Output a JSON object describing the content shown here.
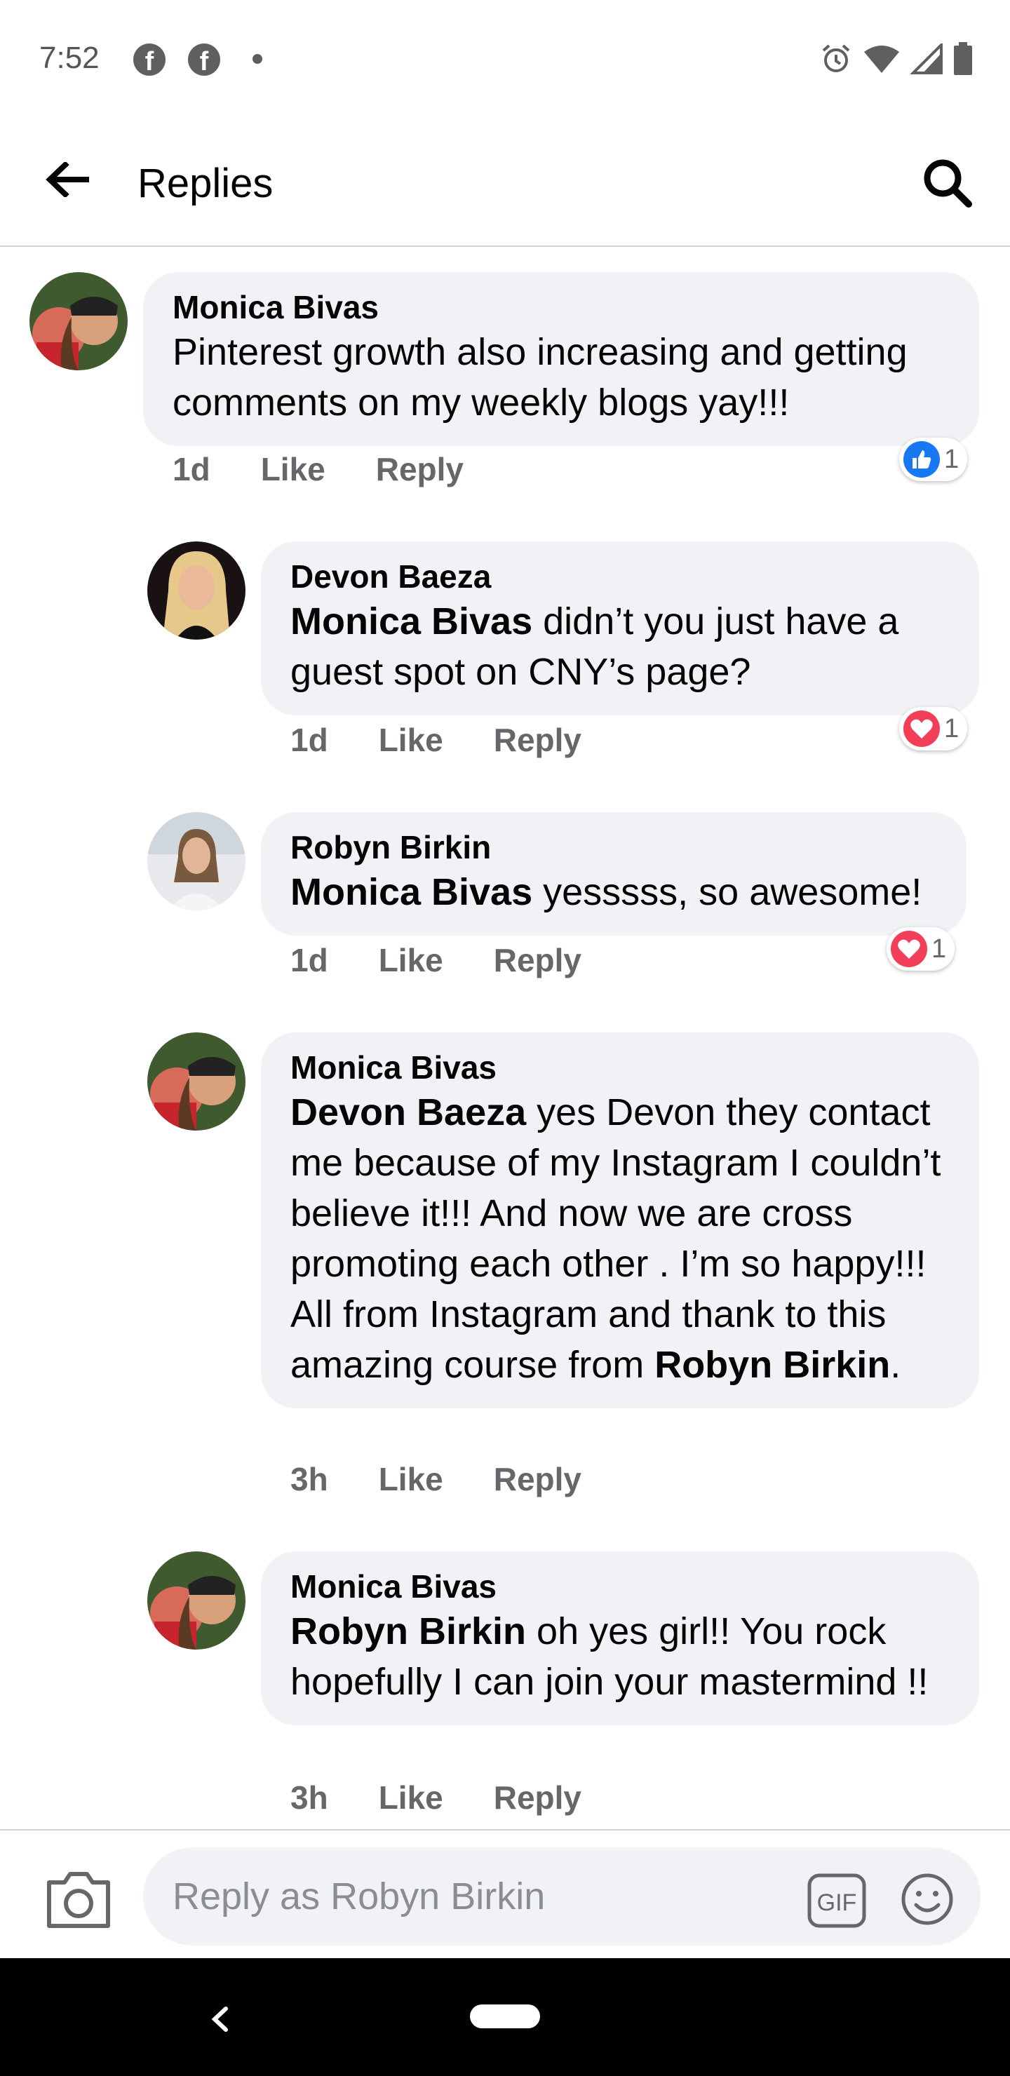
{
  "status_bar": {
    "time": "7:52"
  },
  "app_bar": {
    "title": "Replies"
  },
  "comments": [
    {
      "author": "Monica Bivas",
      "text": "Pinterest growth also increasing and getting comments on my weekly blogs yay!!!",
      "time": "1d",
      "like": "Like",
      "reply": "Reply",
      "reaction": {
        "icon": "thumbs-up-icon",
        "count": "1"
      }
    },
    {
      "author": "Devon Baeza",
      "mention": "Monica Bivas",
      "text": " didn’t you just have a guest spot on CNY’s page?",
      "time": "1d",
      "like": "Like",
      "reply": "Reply",
      "reaction": {
        "icon": "heart-icon",
        "count": "1"
      }
    },
    {
      "author": "Robyn Birkin",
      "mention": "Monica Bivas",
      "text": " yesssss, so awesome!",
      "time": "1d",
      "like": "Like",
      "reply": "Reply",
      "reaction": {
        "icon": "heart-icon",
        "count": "1"
      }
    },
    {
      "author": "Monica Bivas",
      "mention": "Devon Baeza",
      "text": " yes Devon they contact me because of my Instagram I couldn’t believe it!!! And now we are cross promoting each other . I’m so happy!!! All from Instagram and thank to this amazing course from ",
      "mention2": "Robyn Birkin",
      "text2": ".",
      "time": "3h",
      "like": "Like",
      "reply": "Reply"
    },
    {
      "author": "Monica Bivas",
      "mention": "Robyn Birkin",
      "text": " oh yes girl!! You rock hopefully I can join your mastermind !!",
      "time": "3h",
      "like": "Like",
      "reply": "Reply"
    }
  ],
  "reply_bar": {
    "placeholder": "Reply as Robyn Birkin"
  },
  "colors": {
    "like_blue": "#1877f2",
    "heart_red": "#f33e58",
    "bubble_bg": "#f0f2f5",
    "meta_gray": "#65676b"
  }
}
